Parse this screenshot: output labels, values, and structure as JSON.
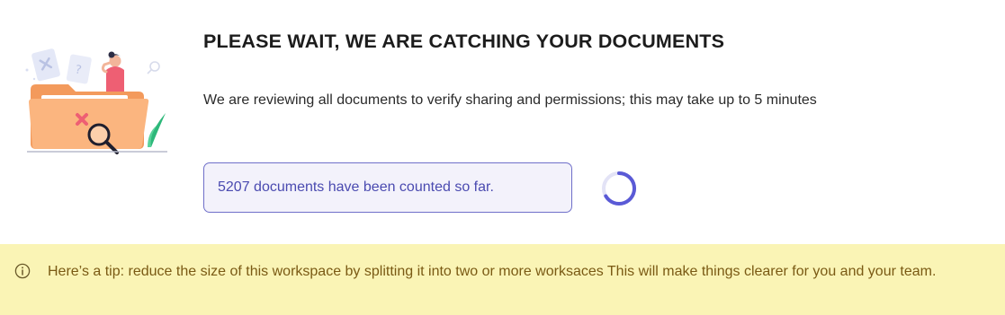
{
  "header": {
    "title": "PLEASE WAIT, WE ARE CATCHING YOUR DOCUMENTS",
    "description": "We are reviewing all documents to verify sharing and permissions; this may take up to 5 minutes"
  },
  "progress": {
    "count_label": "5207 documents have been counted so far.",
    "spinner_icon": "loading-spinner-icon"
  },
  "tip": {
    "icon": "info-icon",
    "text": "Here’s a tip: reduce the size of this workspace by splitting it into two or more worksaces This will make things clearer for you and your team."
  },
  "colors": {
    "accent": "#5a5ad6",
    "tip_background": "#faf4b5",
    "tip_text": "#7a5a14",
    "illustration_folder": "#f7a96b"
  }
}
